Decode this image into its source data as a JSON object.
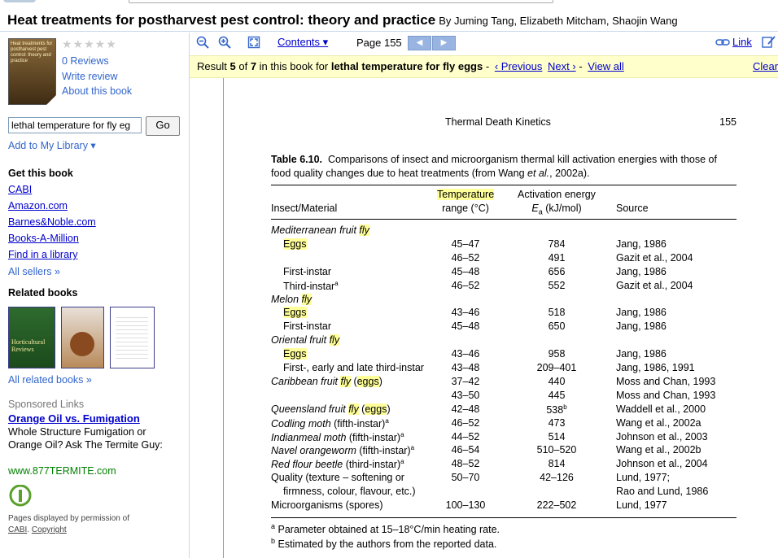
{
  "book": {
    "title": "Heat treatments for postharvest pest control: theory and practice",
    "authors": "By Juming Tang, Elizabeth Mitcham, Shaojin Wang"
  },
  "sidebar": {
    "stars": "★★★★★",
    "reviews": "0 Reviews",
    "write_review": "Write review",
    "about": "About this book",
    "search_value": "lethal temperature for fly eg",
    "go_label": "Go",
    "add_library": "Add to My Library ▾",
    "get_heading": "Get this book",
    "sellers": [
      "CABI",
      "Amazon.com",
      "Barnes&Noble.com",
      "Books-A-Million",
      "Find in a library"
    ],
    "all_sellers": "All sellers »",
    "related_heading": "Related books",
    "related_book_1": "Horticultural Reviews",
    "all_related": "All related books »",
    "sponsored_label": "Sponsored Links",
    "ad_title": "Orange Oil vs. Fumigation",
    "ad_text": "Whole Structure Fumigation or Orange Oil? Ask The Termite Guy:",
    "ad_url": "www.877TERMITE.com",
    "permission_text": "Pages displayed by permission of",
    "permission_publisher": "CABI",
    "copyright": "Copyright"
  },
  "toolbar": {
    "contents": "Contents ▾",
    "page": "Page 155",
    "prev_arrow": "◀",
    "next_arrow": "▶",
    "link": "Link"
  },
  "result": {
    "prefix": "Result",
    "index": "5",
    "of": "of",
    "total": "7",
    "mid": "in this book for",
    "query": "lethal temperature for fly eggs",
    "sep": "-",
    "previous": "‹ Previous",
    "next": "Next ›",
    "view_all": "View all",
    "clear": "Clear"
  },
  "doc": {
    "running_head": "Thermal Death Kinetics",
    "page_number": "155",
    "caption_label": "Table 6.10.",
    "caption_text": "Comparisons of insect and microorganism thermal kill activation energies with those of food quality changes due to heat treatments (from Wang",
    "caption_etal": "et al.",
    "caption_end": ", 2002a).",
    "headers": {
      "col1": "Insect/Material",
      "temp_top": "Temperature",
      "temp_bottom": "range (°C)",
      "act_top": "Activation energy",
      "act_bottom": "E",
      "act_sub": "a",
      "act_unit": " (kJ/mol)",
      "source": "Source"
    },
    "footnote_a": "Parameter obtained at 15–18°C/min heating rate.",
    "footnote_b": "Estimated by the authors from the reported data."
  },
  "table_rows": [
    {
      "label": "Mediterranean fruit ",
      "hl": "fly",
      "style": "italic-group",
      "temp": "",
      "energy": "",
      "source": ""
    },
    {
      "label": "",
      "hl": "Eggs",
      "style": "indent",
      "temp": "45–47",
      "energy": "784",
      "source": "Jang, 1986"
    },
    {
      "label": "",
      "hl": "",
      "style": "indent",
      "temp": "46–52",
      "energy": "491",
      "source": "Gazit et al., 2004"
    },
    {
      "label": "First-instar",
      "hl": "",
      "style": "indent",
      "temp": "45–48",
      "energy": "656",
      "source": "Jang, 1986"
    },
    {
      "label": "Third-instar",
      "sup": "a",
      "hl": "",
      "style": "indent",
      "temp": "46–52",
      "energy": "552",
      "source": "Gazit et al., 2004"
    },
    {
      "label": "Melon ",
      "hl": "fly",
      "style": "italic-group",
      "temp": "",
      "energy": "",
      "source": ""
    },
    {
      "label": "",
      "hl": "Eggs",
      "style": "indent",
      "temp": "43–46",
      "energy": "518",
      "source": "Jang, 1986"
    },
    {
      "label": "First-instar",
      "hl": "",
      "style": "indent",
      "temp": "45–48",
      "energy": "650",
      "source": "Jang, 1986"
    },
    {
      "label": "Oriental fruit ",
      "hl": "fly",
      "style": "italic-group",
      "temp": "",
      "energy": "",
      "source": ""
    },
    {
      "label": "",
      "hl": "Eggs",
      "style": "indent",
      "temp": "43–46",
      "energy": "958",
      "source": "Jang, 1986"
    },
    {
      "label": "First-, early and late third-instar",
      "hl": "",
      "style": "indent",
      "temp": "43–48",
      "energy": "209–401",
      "source": "Jang, 1986, 1991"
    },
    {
      "label": "Caribbean fruit ",
      "hl": "fly",
      "tail": " (eggs)",
      "style": "italic-group",
      "temp": "37–42",
      "energy": "440",
      "source": "Moss and Chan, 1993"
    },
    {
      "label": "",
      "hl": "",
      "style": "indent",
      "temp": "43–50",
      "energy": "445",
      "source": "Moss and Chan, 1993"
    },
    {
      "label": "Queensland fruit ",
      "hl": "fly",
      "tail": " (eggs)",
      "style": "italic-group",
      "temp": "42–48",
      "energy": "538",
      "esup": "b",
      "source": "Waddell et al., 2000"
    },
    {
      "label": "Codling moth",
      "tail": " (fifth-instar)",
      "sup": "a",
      "hl": "",
      "style": "italic-group",
      "temp": "46–52",
      "energy": "473",
      "source": "Wang et al., 2002a"
    },
    {
      "label": "Indianmeal moth",
      "tail": " (fifth-instar)",
      "sup": "a",
      "hl": "",
      "style": "italic-group",
      "temp": "44–52",
      "energy": "514",
      "source": "Johnson et al., 2003"
    },
    {
      "label": "Navel orangeworm",
      "tail": " (fifth-instar)",
      "sup": "a",
      "hl": "",
      "style": "italic-group",
      "temp": "46–54",
      "energy": "510–520",
      "source": "Wang et al., 2002b"
    },
    {
      "label": "Red flour beetle",
      "tail": " (third-instar)",
      "sup": "a",
      "hl": "",
      "style": "italic-group",
      "temp": "48–52",
      "energy": "814",
      "source": "Johnson et al., 2004"
    },
    {
      "label": "Quality (texture – softening or",
      "hl": "",
      "style": "plain",
      "temp": "50–70",
      "energy": "42–126",
      "source": "Lund, 1977;"
    },
    {
      "label": "firmness, colour, flavour, etc.)",
      "hl": "",
      "style": "indent",
      "temp": "",
      "energy": "",
      "source": "Rao and Lund, 1986"
    },
    {
      "label": "Microorganisms (spores)",
      "hl": "",
      "style": "plain",
      "temp": "100–130",
      "energy": "222–502",
      "source": "Lund, 1977"
    }
  ]
}
